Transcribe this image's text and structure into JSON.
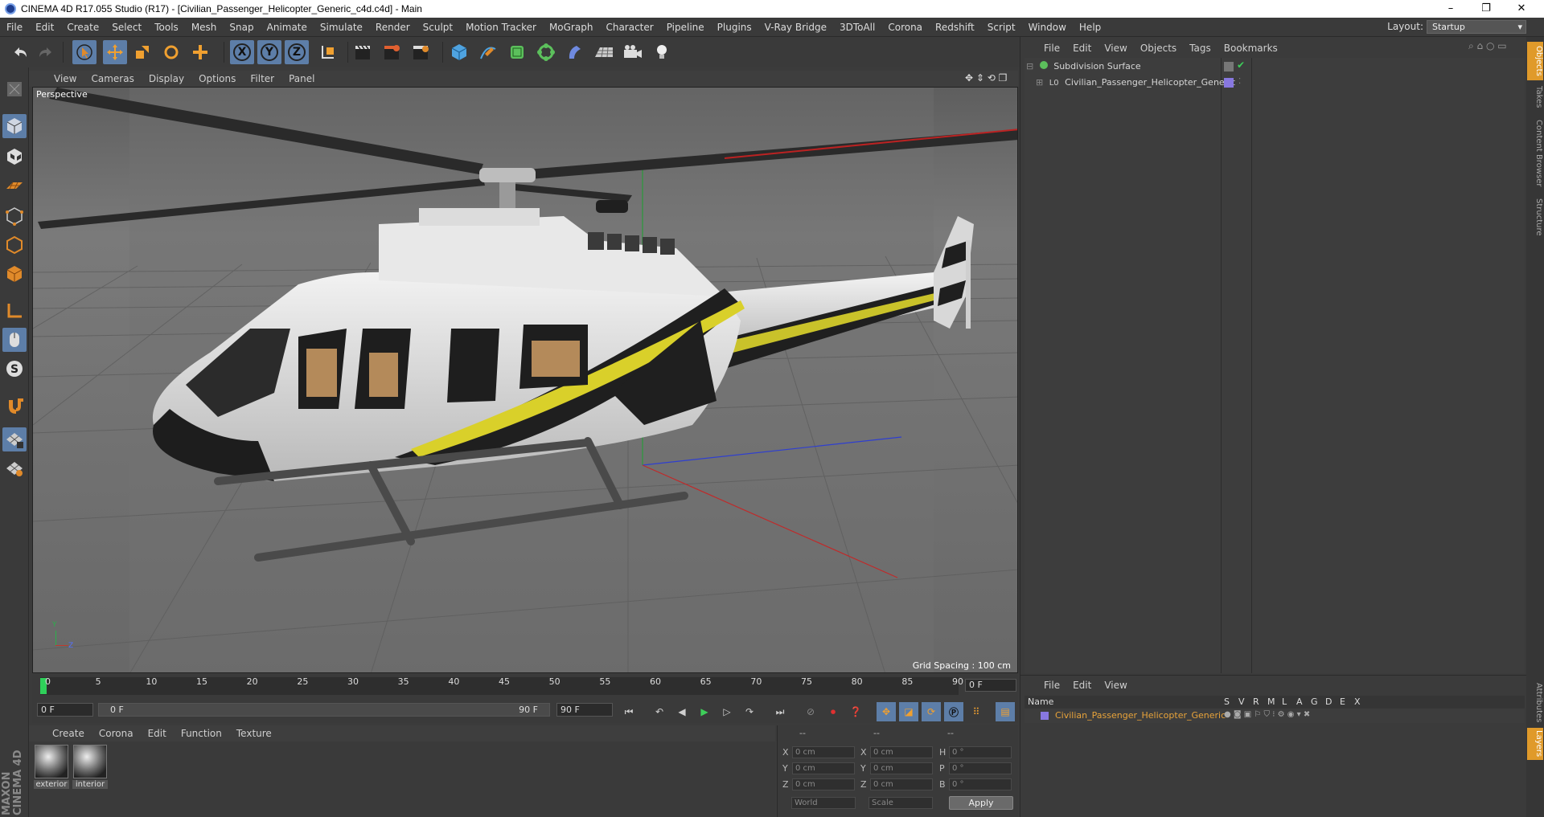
{
  "window": {
    "title": "CINEMA 4D R17.055 Studio (R17) - [Civilian_Passenger_Helicopter_Generic_c4d.c4d] - Main",
    "controls": [
      "–",
      "❐",
      "✕"
    ]
  },
  "menubar": {
    "items": [
      "File",
      "Edit",
      "Create",
      "Select",
      "Tools",
      "Mesh",
      "Snap",
      "Animate",
      "Simulate",
      "Render",
      "Sculpt",
      "Motion Tracker",
      "MoGraph",
      "Character",
      "Pipeline",
      "Plugins",
      "V-Ray Bridge",
      "3DToAll",
      "Corona",
      "Redshift",
      "Script",
      "Window",
      "Help"
    ],
    "layout_label": "Layout:",
    "layout_value": "Startup"
  },
  "toolbar": {
    "axis_x": "X",
    "axis_y": "Y",
    "axis_z": "Z"
  },
  "viewport": {
    "menu": [
      "View",
      "Cameras",
      "Display",
      "Options",
      "Filter",
      "Panel"
    ],
    "label": "Perspective",
    "grid_spacing": "Grid Spacing : 100 cm",
    "axis_y": "Y",
    "axis_z": "Z"
  },
  "timeline": {
    "ticks": [
      "0",
      "5",
      "10",
      "15",
      "20",
      "25",
      "30",
      "35",
      "40",
      "45",
      "50",
      "55",
      "60",
      "65",
      "70",
      "75",
      "80",
      "85",
      "90"
    ],
    "current_frame": "0 F",
    "start_field": "0 F",
    "range_start": "0 F",
    "range_end": "90 F",
    "end_field": "90 F"
  },
  "materials": {
    "menu": [
      "Create",
      "Corona",
      "Edit",
      "Function",
      "Texture"
    ],
    "items": [
      {
        "name": "exterior"
      },
      {
        "name": "interior"
      }
    ]
  },
  "coordinates": {
    "headers": [
      "--",
      "--",
      "--"
    ],
    "rows": [
      {
        "a": "X",
        "av": "0 cm",
        "b": "X",
        "bv": "0 cm",
        "c": "H",
        "cv": "0 °"
      },
      {
        "a": "Y",
        "av": "0 cm",
        "b": "Y",
        "bv": "0 cm",
        "c": "P",
        "cv": "0 °"
      },
      {
        "a": "Z",
        "av": "0 cm",
        "b": "Z",
        "bv": "0 cm",
        "c": "B",
        "cv": "0 °"
      }
    ],
    "mode": "World",
    "transform": "Scale",
    "apply": "Apply"
  },
  "objects": {
    "menu": [
      "File",
      "Edit",
      "View",
      "Objects",
      "Tags",
      "Bookmarks"
    ],
    "rows": [
      {
        "name": "Subdivision Surface"
      },
      {
        "name": "Civilian_Passenger_Helicopter_Generic"
      }
    ]
  },
  "side_tabs": [
    "Objects",
    "Takes",
    "Content Browser",
    "Structure"
  ],
  "side_tabs_bottom": [
    "Attributes",
    "Layers"
  ],
  "layers": {
    "menu": [
      "File",
      "Edit",
      "View"
    ],
    "header_name": "Name",
    "header_cols": [
      "S",
      "V",
      "R",
      "M",
      "L",
      "A",
      "G",
      "D",
      "E",
      "X"
    ],
    "row_name": "Civilian_Passenger_Helicopter_Generic"
  },
  "colors": {
    "accent_blue": "#5d7ea8",
    "layer_text": "#e8a33a",
    "active_tab": "#e09a2a"
  },
  "branding": "MAXON CINEMA 4D"
}
